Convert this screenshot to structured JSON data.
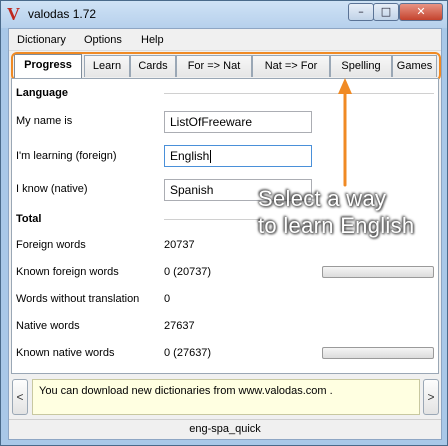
{
  "window": {
    "title": "valodas 1.72",
    "app_icon": "V"
  },
  "title_controls": {
    "minimize": "–",
    "maximize": "□",
    "close": "✕"
  },
  "menu": [
    "Dictionary",
    "Options",
    "Help"
  ],
  "tabs": [
    {
      "label": "Progress",
      "active": true
    },
    {
      "label": "Learn",
      "active": false
    },
    {
      "label": "Cards",
      "active": false
    },
    {
      "label": "For => Nat",
      "active": false
    },
    {
      "label": "Nat => For",
      "active": false
    },
    {
      "label": "Spelling",
      "active": false
    },
    {
      "label": "Games",
      "active": false
    }
  ],
  "language": {
    "section_title": "Language",
    "name_label": "My name is",
    "name_value": "ListOfFreeware",
    "foreign_label": "I'm learning (foreign)",
    "foreign_value": "English",
    "native_label": "I know (native)",
    "native_value": "Spanish"
  },
  "total": {
    "section_title": "Total",
    "rows": [
      {
        "label": "Foreign words",
        "value": "20737",
        "progress": null
      },
      {
        "label": "Known foreign words",
        "value": "0 (20737)",
        "progress": 0
      },
      {
        "label": "Words without translation",
        "value": "0",
        "progress": null
      },
      {
        "label": "Native words",
        "value": "27637",
        "progress": null
      },
      {
        "label": "Known native words",
        "value": "0 (27637)",
        "progress": 0
      }
    ]
  },
  "callout": {
    "line1": "Select a way",
    "line2": "to learn English",
    "color": "#f08a24"
  },
  "message": {
    "text": "You can download new dictionaries from www.valodas.com .",
    "prev": "<",
    "next": ">"
  },
  "status": {
    "dictionary": "eng-spa_quick"
  }
}
